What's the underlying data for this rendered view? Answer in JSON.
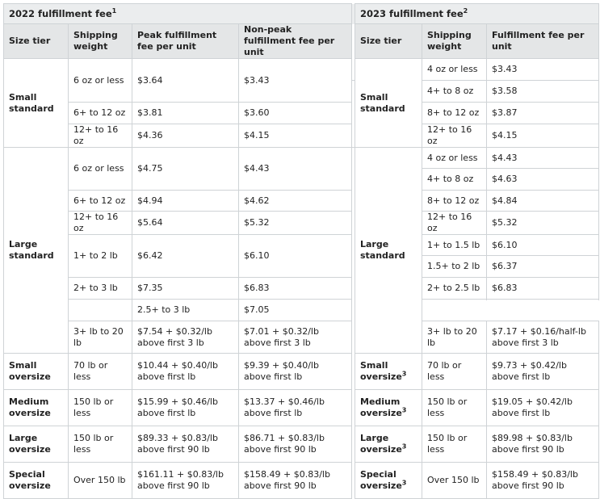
{
  "t22": {
    "title": "2022 fulfillment fee",
    "title_sup": "1",
    "headers": [
      "Size tier",
      "Shipping weight",
      "Peak fulfillment fee per unit",
      "Non-peak fulfillment fee per unit"
    ],
    "tiers": {
      "small_standard": "Small standard",
      "large_standard": "Large standard",
      "small_oversize": "Small oversize",
      "medium_oversize": "Medium oversize",
      "large_oversize": "Large oversize",
      "special_oversize": "Special oversize"
    },
    "rows": [
      {
        "w": "6 oz or less",
        "peak": "$3.64",
        "nonpeak": "$3.43"
      },
      {
        "w": "6+ to 12 oz",
        "peak": "$3.81",
        "nonpeak": "$3.60"
      },
      {
        "w": "12+ to 16 oz",
        "peak": "$4.36",
        "nonpeak": "$4.15"
      },
      {
        "w": "6 oz or less",
        "peak": "$4.75",
        "nonpeak": "$4.43"
      },
      {
        "w": "6+ to 12 oz",
        "peak": "$4.94",
        "nonpeak": "$4.62"
      },
      {
        "w": "12+ to 16 oz",
        "peak": "$5.64",
        "nonpeak": "$5.32"
      },
      {
        "w": "1+ to 2 lb",
        "peak": "$6.42",
        "nonpeak": "$6.10"
      },
      {
        "w": "2+ to 3 lb",
        "peak": "$7.35",
        "nonpeak": "$6.83"
      },
      {
        "w": "3+ lb to 20 lb",
        "peak": "$7.54 + $0.32/lb above first 3 lb",
        "nonpeak": "$7.01 + $0.32/lb above first 3 lb"
      },
      {
        "w": "70 lb or less",
        "peak": "$10.44 + $0.40/lb above first lb",
        "nonpeak": "$9.39 + $0.40/lb above first lb"
      },
      {
        "w": "150 lb or less",
        "peak": "$15.99 + $0.46/lb above first lb",
        "nonpeak": "$13.37 + $0.46/lb above first lb"
      },
      {
        "w": "150 lb or less",
        "peak": "$89.33 + $0.83/lb above first 90 lb",
        "nonpeak": "$86.71 + $0.83/lb above first 90 lb"
      },
      {
        "w": "Over 150 lb",
        "peak": "$161.11 + $0.83/lb above first 90 lb",
        "nonpeak": "$158.49 + $0.83/lb above first 90 lb"
      }
    ]
  },
  "t23": {
    "title": "2023 fulfillment fee",
    "title_sup": "2",
    "headers": [
      "Size tier",
      "Shipping weight",
      "Fulfillment fee per unit"
    ],
    "tiers": {
      "small_standard": "Small standard",
      "large_standard": "Large standard",
      "small_oversize": "Small oversize",
      "medium_oversize": "Medium oversize",
      "large_oversize": "Large oversize",
      "special_oversize": "Special oversize"
    },
    "tier_sup": "3",
    "rows": [
      {
        "w": "4 oz or less",
        "fee": "$3.43"
      },
      {
        "w": "4+ to 8 oz",
        "fee": "$3.58"
      },
      {
        "w": "8+ to 12 oz",
        "fee": "$3.87"
      },
      {
        "w": "12+ to 16 oz",
        "fee": "$4.15"
      },
      {
        "w": "4 oz or less",
        "fee": "$4.43"
      },
      {
        "w": "4+ to 8 oz",
        "fee": "$4.63"
      },
      {
        "w": "8+ to 12 oz",
        "fee": "$4.84"
      },
      {
        "w": "12+ to 16 oz",
        "fee": "$5.32"
      },
      {
        "w": "1+ to 1.5 lb",
        "fee": "$6.10"
      },
      {
        "w": "1.5+ to 2 lb",
        "fee": "$6.37"
      },
      {
        "w": "2+ to 2.5 lb",
        "fee": "$6.83"
      },
      {
        "w": "2.5+ to 3 lb",
        "fee": "$7.05"
      },
      {
        "w": "3+ lb to 20 lb",
        "fee": "$7.17 + $0.16/half-lb above first 3 lb"
      },
      {
        "w": "70 lb or less",
        "fee": "$9.73 + $0.42/lb above first lb"
      },
      {
        "w": "150 lb or less",
        "fee": "$19.05 + $0.42/lb above first lb"
      },
      {
        "w": "150 lb or less",
        "fee": "$89.98 + $0.83/lb above first 90 lb"
      },
      {
        "w": "Over 150 lb",
        "fee": "$158.49 + $0.83/lb above first 90 lb"
      }
    ]
  }
}
